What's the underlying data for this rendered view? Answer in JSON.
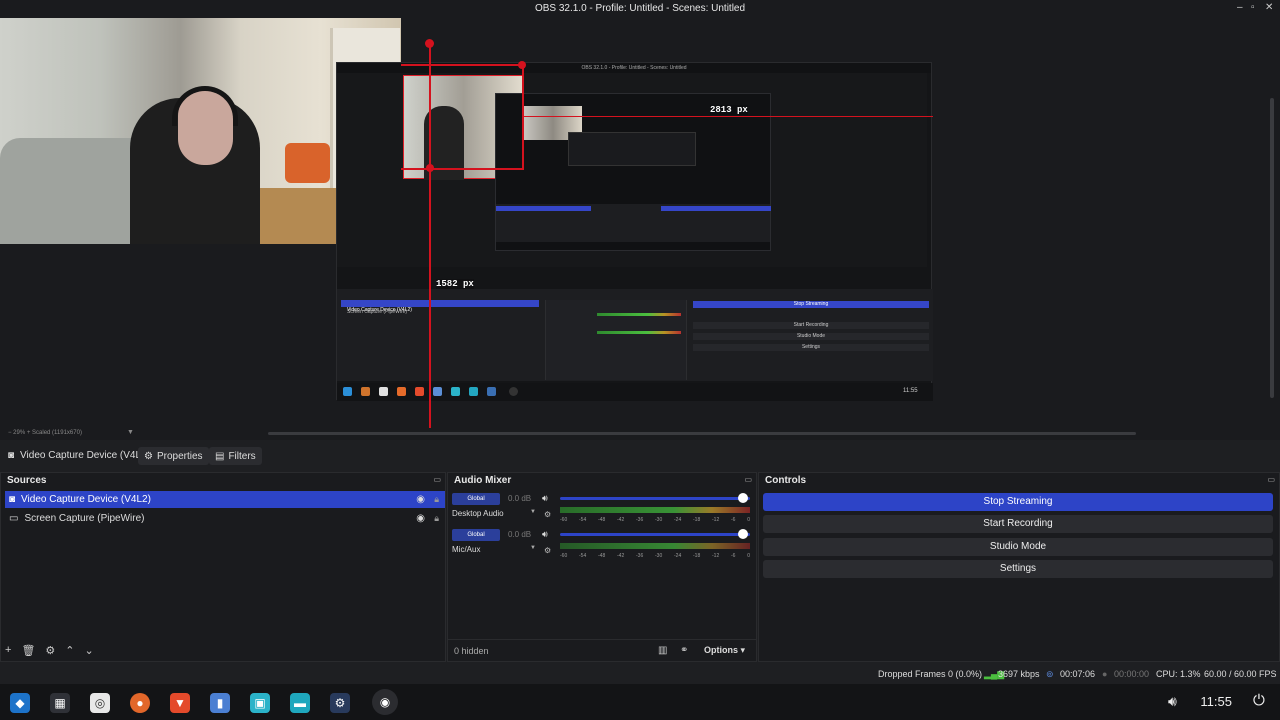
{
  "window": {
    "title": "OBS 32.1.0 - Profile: Untitled - Scenes: Untitled"
  },
  "preview": {
    "width_label": "2813 px",
    "height_label": "1582 px",
    "inner_title": "OBS 32.1.0 - Profile: Untitled - Scenes: Untitled",
    "inner_src1": "Video Capture Device (V4L2)",
    "inner_src2": "Screen Capture (PipeWire)",
    "inner_controls": [
      "Stop Streaming",
      "Start Recording",
      "Studio Mode",
      "Settings"
    ],
    "inner_clock": "11:55"
  },
  "zoom": {
    "text": "− 29% +  Scaled (1191x670)"
  },
  "context": {
    "source_name": "Video Capture Device (V4L",
    "properties": "Properties",
    "filters": "Filters"
  },
  "sources": {
    "title": "Sources",
    "items": [
      {
        "label": "Video Capture Device (V4L2)"
      },
      {
        "label": "Screen Capture (PipeWire)"
      }
    ]
  },
  "mixer": {
    "title": "Audio Mixer",
    "channels": [
      {
        "tag": "Global",
        "db": "0.0 dB",
        "device": "Desktop Audio"
      },
      {
        "tag": "Global",
        "db": "0.0 dB",
        "device": "Mic/Aux"
      }
    ],
    "scale": [
      "-60",
      "-54",
      "-48",
      "-42",
      "-36",
      "-30",
      "-24",
      "-18",
      "-12",
      "-6",
      "0"
    ],
    "hidden": "0 hidden",
    "options": "Options"
  },
  "controls": {
    "title": "Controls",
    "buttons": [
      "Stop Streaming",
      "Start Recording",
      "Studio Mode",
      "Settings"
    ]
  },
  "status": {
    "dropped": "Dropped Frames 0 (0.0%)",
    "bitrate": "3697 kbps",
    "stream_time": "00:07:06",
    "rec_time": "00:00:00",
    "cpu": "CPU: 1.3%",
    "fps": "60.00 / 60.00 FPS"
  },
  "taskbar": {
    "clock": "11:55"
  },
  "colors": {
    "accent": "#2d44c7",
    "guide": "#d4121e",
    "background": "#1e1f22"
  }
}
